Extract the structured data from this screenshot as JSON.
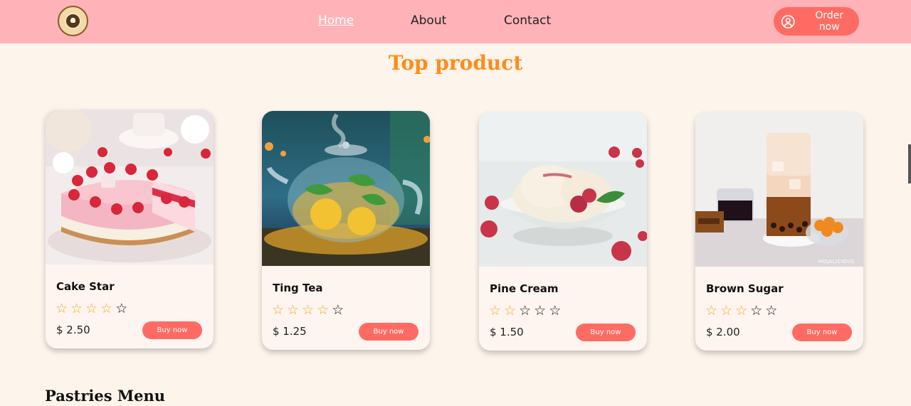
{
  "nav": {
    "links": [
      {
        "label": "Home",
        "active": true
      },
      {
        "label": "About",
        "active": false
      },
      {
        "label": "Contact",
        "active": false
      }
    ],
    "order_label": "Order now"
  },
  "section_title": "Top product",
  "products": [
    {
      "name": "Cake Star",
      "rating": 4,
      "max_rating": 5,
      "price": "$ 2.50",
      "button": "Buy now",
      "image": "strawberry-cheesecake"
    },
    {
      "name": "Ting Tea",
      "rating": 4,
      "max_rating": 5,
      "price": "$ 1.25",
      "button": "Buy now",
      "image": "glass-teapot"
    },
    {
      "name": "Pine Cream",
      "rating": 2,
      "max_rating": 5,
      "price": "$ 1.50",
      "button": "Buy now",
      "image": "ice-cream-bowl"
    },
    {
      "name": "Brown Sugar",
      "rating": 3,
      "max_rating": 5,
      "price": "$ 2.00",
      "button": "Buy now",
      "image": "bubble-tea-glass",
      "image_caption": "HOJALICIOUS"
    }
  ],
  "menu_title": "Pastries Menu",
  "colors": {
    "navbar": "#ffb3b8",
    "accent": "#ff6b62",
    "title": "#ff8c1a",
    "star": "#f5a623",
    "background": "#fdf4ec"
  }
}
